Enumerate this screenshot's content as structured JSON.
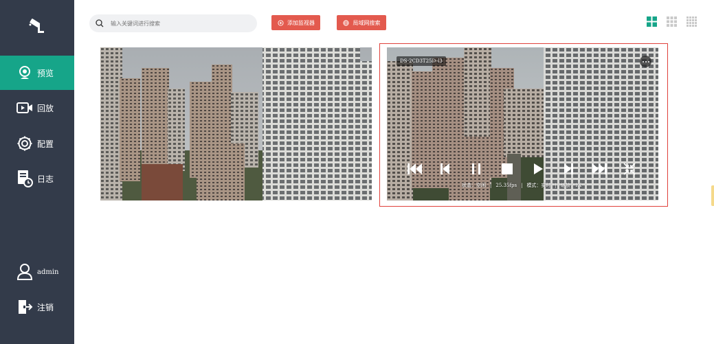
{
  "sidebar": {
    "logo_icon": "camera-icon",
    "items": [
      {
        "key": "preview",
        "label": "预览",
        "icon": "webcam-icon",
        "active": true
      },
      {
        "key": "playback",
        "label": "回放",
        "icon": "video-play-icon",
        "active": false
      },
      {
        "key": "config",
        "label": "配置",
        "icon": "gear-icon",
        "active": false
      },
      {
        "key": "log",
        "label": "日志",
        "icon": "log-document-icon",
        "active": false
      }
    ],
    "user": {
      "label": "admin",
      "icon": "user-icon"
    },
    "logout": {
      "label": "注销",
      "icon": "logout-icon"
    }
  },
  "toolbar": {
    "search_placeholder": "输入关键词进行搜索",
    "add_monitor": "添加监视器",
    "lan_search": "局域网搜索",
    "layouts": [
      "grid-2x2-icon",
      "grid-3x3-icon",
      "grid-4x4-icon"
    ],
    "active_layout": 0
  },
  "videos": [
    {
      "label": "",
      "selected": false
    },
    {
      "label": "DS-2CD3T25D-I3",
      "selected": true,
      "controls": [
        "fast-rewind-icon",
        "previous-frame-icon",
        "pause-icon",
        "stop-icon",
        "play-icon",
        "next-frame-icon",
        "fast-forward-icon",
        "exit-fullscreen-icon"
      ],
      "status": {
        "state": "状态：空闲",
        "fps": "25.35fps",
        "mode": "模式：实时",
        "zoom": "缩放：1X",
        "separator": "|"
      }
    }
  ],
  "colors": {
    "sidebar": "#333b4a",
    "accent": "#16a589",
    "button": "#e35a4e",
    "selection": "#e0403a"
  }
}
